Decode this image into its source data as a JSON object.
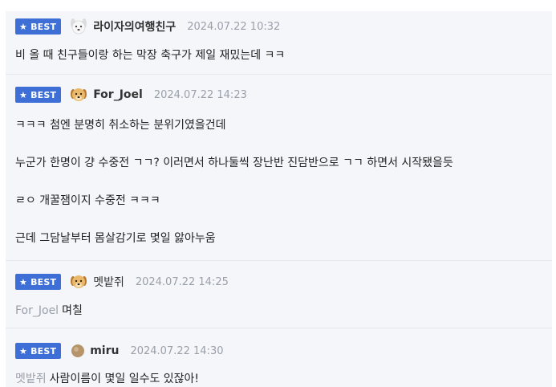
{
  "badge_label": "BEST",
  "colors": {
    "badge_bg": "#3d6fd6",
    "comment_bg": "#f4f6fa",
    "meta_gray": "#9aa0aa"
  },
  "comments": [
    {
      "nickname": "라이자의여행친구",
      "avatar_icon": "white-puppy-icon",
      "date": "2024.07.22 10:32",
      "lines": [
        "비 올 때 친구들이랑 하는 막장 축구가 제일 재밌는데 ㅋㅋ"
      ]
    },
    {
      "nickname": "For_Joel",
      "avatar_icon": "golden-puppy-icon",
      "date": "2024.07.22 14:23",
      "lines": [
        "ㅋㅋㅋ 첨엔 분명히 취소하는 분위기였을건데",
        "누군가 한명이 걍 수중전 ㄱㄱ? 이러면서 하나둘씩 장난반 진담반으로 ㄱㄱ 하면서 시작됐을듯",
        "ㄹㅇ 개꿀잼이지 수중전 ㅋㅋㅋ",
        "근데 그담날부터 몸살감기로 몇일 앓아누움"
      ]
    },
    {
      "nickname": "멧밭쥐",
      "avatar_icon": "golden-puppy-icon",
      "date": "2024.07.22 14:25",
      "mention": "For_Joel",
      "lines": [
        "며칠"
      ]
    },
    {
      "nickname": "miru",
      "avatar_icon": "round-avatar-icon",
      "date": "2024.07.22 14:30",
      "mention": "멧밭쥐",
      "lines": [
        "사람이름이 몇일 일수도 있잖아!"
      ]
    }
  ]
}
